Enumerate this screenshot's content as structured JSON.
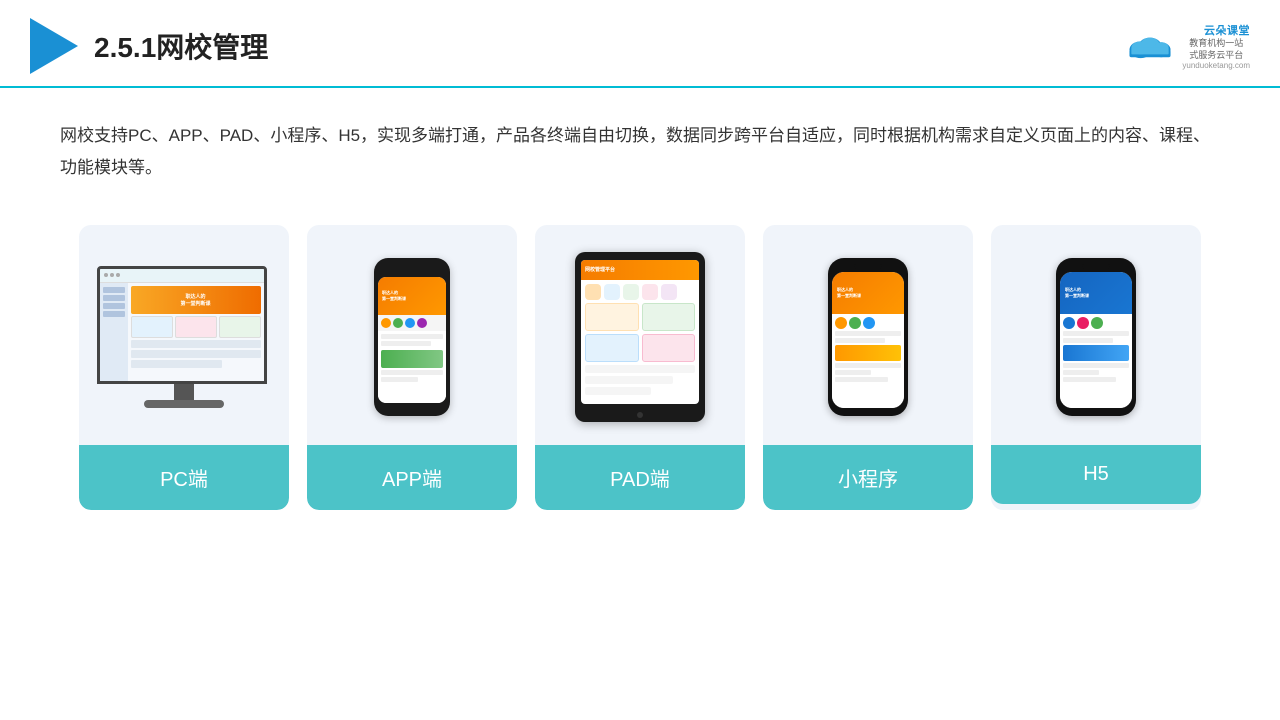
{
  "header": {
    "section_number": "2.5.1",
    "title": "网校管理",
    "brand": {
      "name": "云朵课堂",
      "url": "yunduoketang.com",
      "tagline1": "教育机构一站",
      "tagline2": "式服务云平台"
    }
  },
  "description": {
    "text": "网校支持PC、APP、PAD、小程序、H5，实现多端打通，产品各终端自由切换，数据同步跨平台自适应，同时根据机构需求自定义页面上的内容、课程、功能模块等。"
  },
  "cards": [
    {
      "id": "pc",
      "label": "PC端"
    },
    {
      "id": "app",
      "label": "APP端"
    },
    {
      "id": "pad",
      "label": "PAD端"
    },
    {
      "id": "miniprogram",
      "label": "小程序"
    },
    {
      "id": "h5",
      "label": "H5"
    }
  ]
}
